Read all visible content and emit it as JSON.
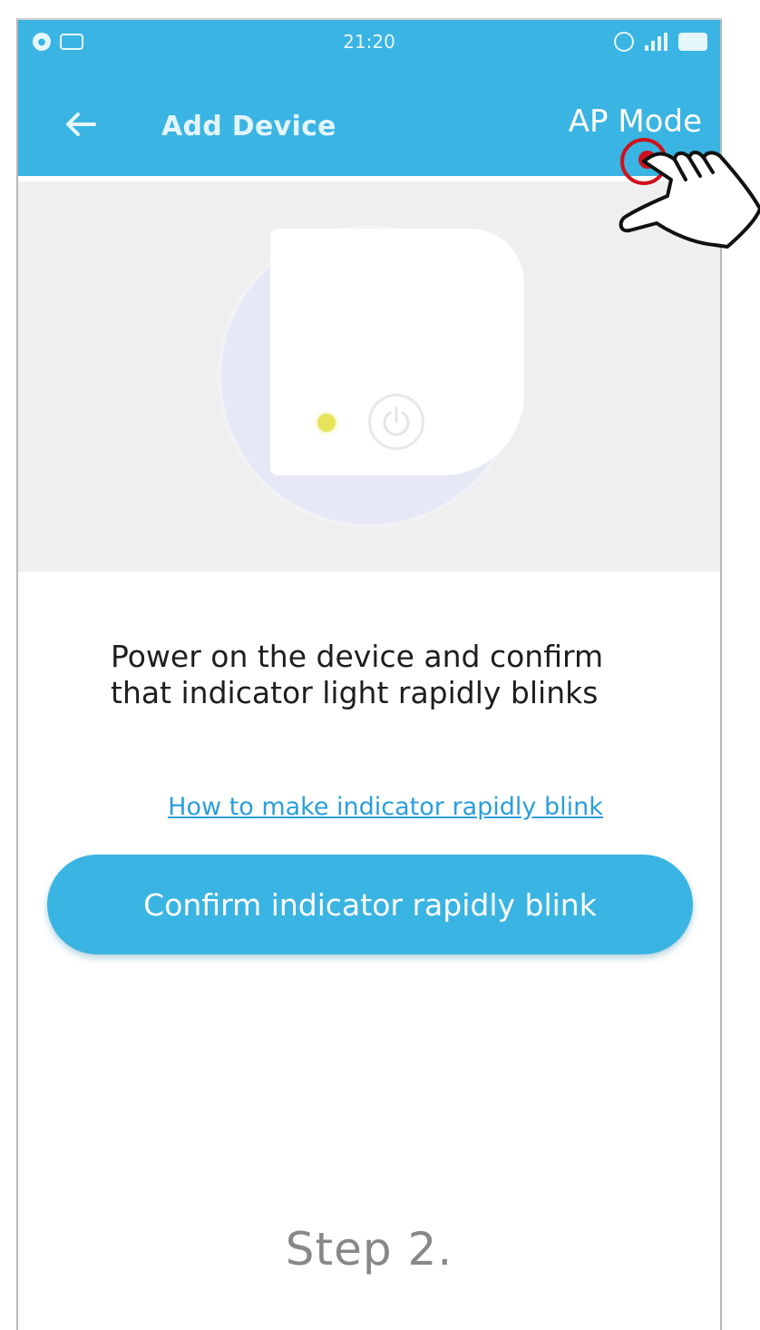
{
  "status_bar": {
    "time": "21:20",
    "left_icons": [
      "notification-icon",
      "message-icon"
    ],
    "right_icons": [
      "wifi-icon",
      "signal-icon",
      "battery-icon"
    ]
  },
  "toolbar": {
    "back_icon": "arrow-left-icon",
    "title": "Add Device",
    "ap_mode_label": "AP Mode"
  },
  "illustration": {
    "indicator_color": "#e7e35a",
    "power_icon": "power-icon"
  },
  "instruction": {
    "line1": "Power on the device and confirm",
    "line2": "that indicator light rapidly blinks"
  },
  "help_link": "How to make indicator rapidly blink",
  "confirm_button": "Confirm indicator rapidly blink",
  "step_label": "Step 2.",
  "colors": {
    "accent": "#3ab4e2",
    "link": "#2a9fdc",
    "tap_highlight": "#d0111c"
  }
}
